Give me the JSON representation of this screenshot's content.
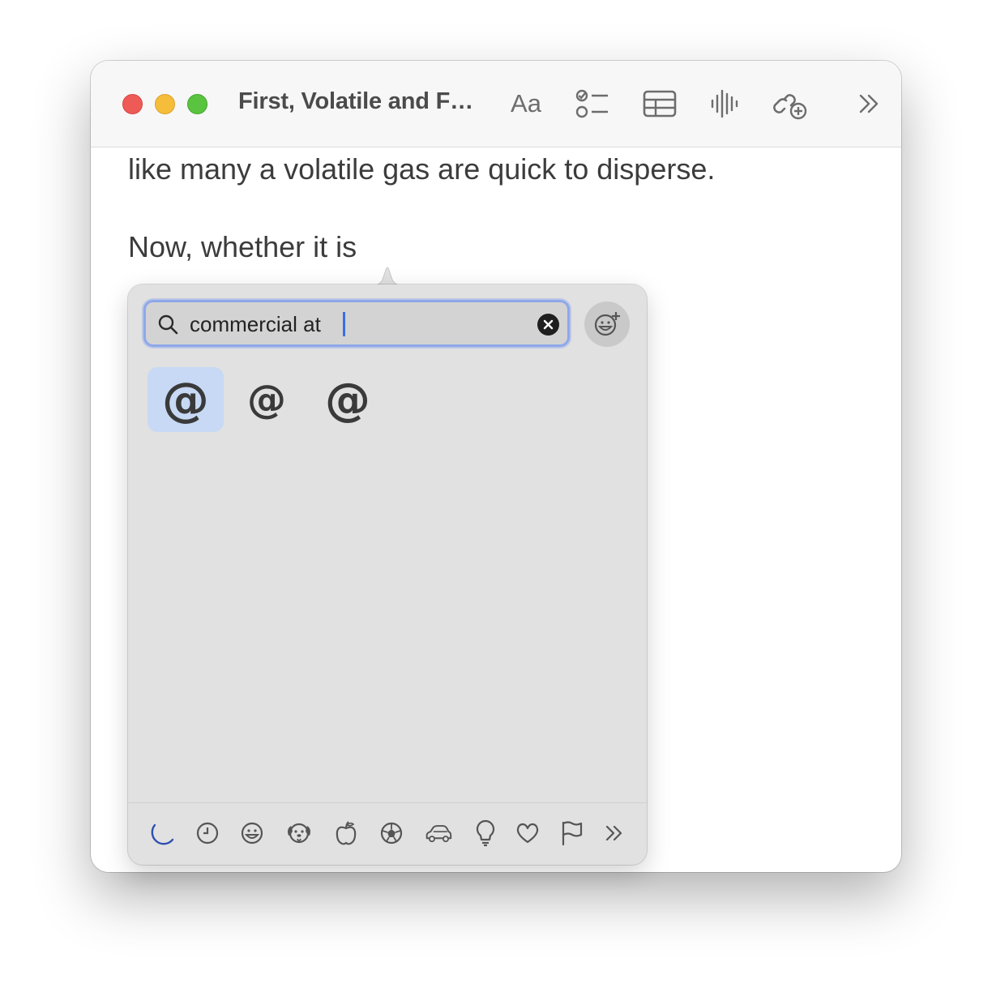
{
  "window": {
    "title": "First, Volatile and F…",
    "toolbar": {
      "format_label": "Aa",
      "icons": [
        "checklist-icon",
        "table-icon",
        "audio-waveform-icon",
        "collaborate-icon",
        "more-icon"
      ]
    }
  },
  "document": {
    "line1": "like many a volatile gas are quick to disperse.",
    "line2": "Now, whether it is"
  },
  "emoji_picker": {
    "search": {
      "value": "commercial at",
      "placeholder": "Search"
    },
    "results": [
      "@",
      "@",
      "@"
    ],
    "selected_index": 0,
    "categories": [
      "stickers-icon",
      "recent-clock-icon",
      "smiley-icon",
      "dog-face-icon",
      "apple-icon",
      "soccer-ball-icon",
      "car-icon",
      "lightbulb-icon",
      "heart-icon",
      "flag-icon",
      "more-categories-icon"
    ],
    "accent_color": "#8ea8ea",
    "selected_color": "#c7d9f4"
  }
}
